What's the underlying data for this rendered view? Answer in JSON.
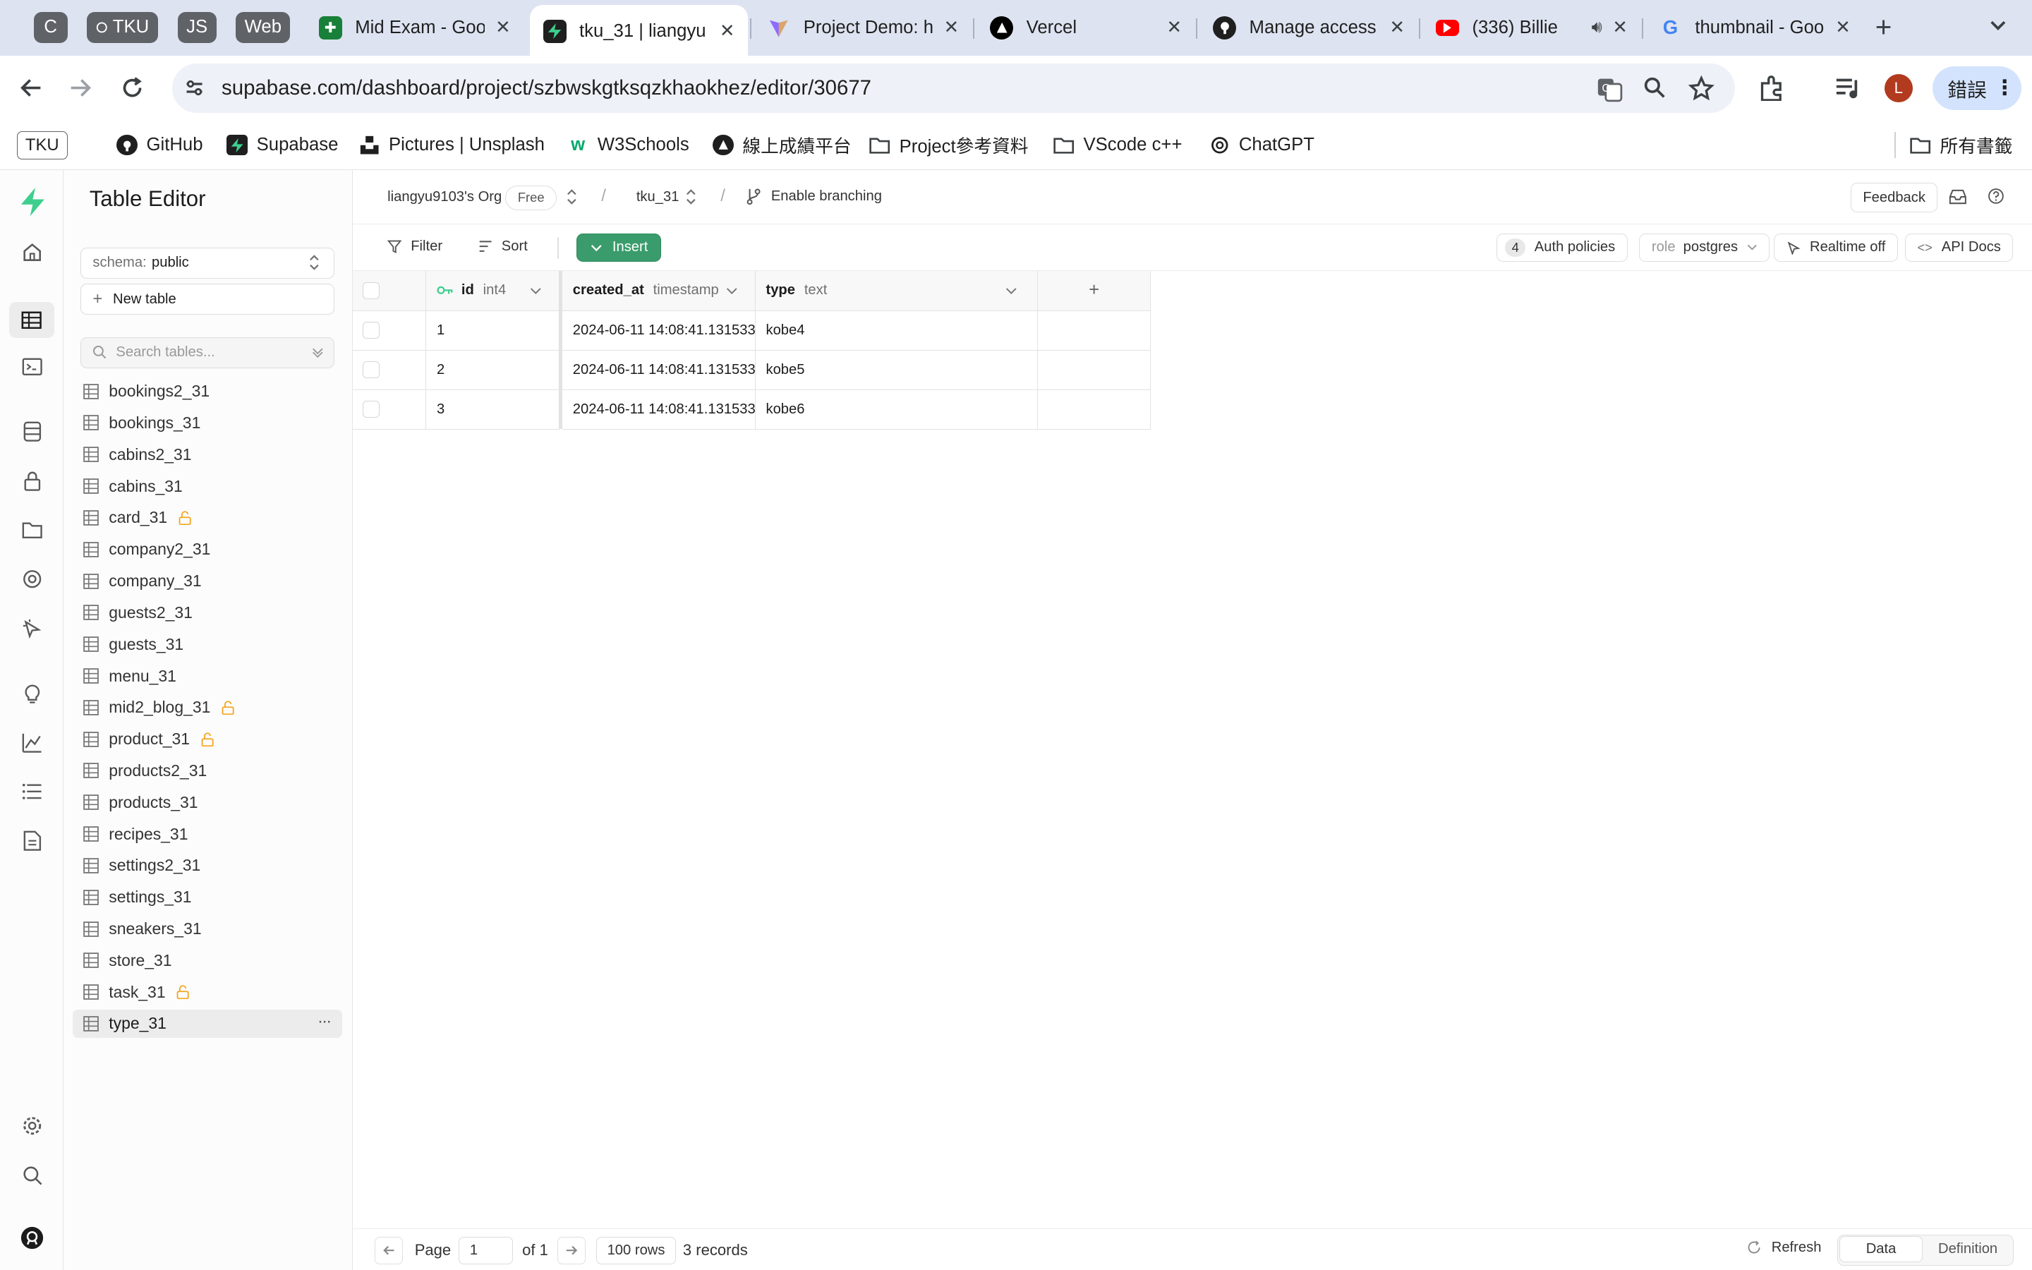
{
  "browser": {
    "tab_groups": [
      "C",
      "TKU",
      "JS",
      "Web"
    ],
    "tabs": [
      {
        "title": "Mid Exam - Goo",
        "favicon": "sheets-icon",
        "color": "#188038"
      },
      {
        "title": "tku_31 | liangyu",
        "favicon": "supabase-icon",
        "color": "#1f1f1f"
      },
      {
        "title": "Project Demo: h",
        "favicon": "vite-icon",
        "color": "#8a6cff"
      },
      {
        "title": "Vercel",
        "favicon": "vercel-icon",
        "color": "#000000"
      },
      {
        "title": "Manage access",
        "favicon": "github-icon",
        "color": "#1f1f1f"
      },
      {
        "title": "(336) Billie",
        "favicon": "youtube-icon",
        "color": "#ff0000"
      },
      {
        "title": "thumbnail - Goo",
        "favicon": "google-icon",
        "color": "#4285f4"
      }
    ],
    "url_host": "supabase.com",
    "url_path": "/dashboard/project/szbwskgtksqzkhaokhez/editor/30677",
    "profile_initial": "L",
    "error_button": "錯誤",
    "bookmarks": [
      {
        "label": "TKU",
        "icon": "tku-badge"
      },
      {
        "label": "GitHub",
        "icon": "github-icon"
      },
      {
        "label": "Supabase",
        "icon": "supabase-icon"
      },
      {
        "label": "Pictures | Unsplash",
        "icon": "unsplash-icon"
      },
      {
        "label": "W3Schools",
        "icon": "w3schools-icon"
      },
      {
        "label": "線上成績平台",
        "icon": "triangle-logo-icon"
      },
      {
        "label": "Project參考資料",
        "icon": "folder-icon"
      },
      {
        "label": "VScode c++",
        "icon": "folder-icon"
      },
      {
        "label": "ChatGPT",
        "icon": "chatgpt-icon"
      }
    ],
    "all_bookmarks": "所有書籤"
  },
  "sidebar": {
    "title": "Table Editor",
    "schema_label": "schema:",
    "schema_value": "public",
    "new_table": "New table",
    "search_placeholder": "Search tables...",
    "tables": [
      {
        "name": "bookings2_31",
        "locked": false
      },
      {
        "name": "bookings_31",
        "locked": false
      },
      {
        "name": "cabins2_31",
        "locked": false
      },
      {
        "name": "cabins_31",
        "locked": false
      },
      {
        "name": "card_31",
        "locked": true
      },
      {
        "name": "company2_31",
        "locked": false
      },
      {
        "name": "company_31",
        "locked": false
      },
      {
        "name": "guests2_31",
        "locked": false
      },
      {
        "name": "guests_31",
        "locked": false
      },
      {
        "name": "menu_31",
        "locked": false
      },
      {
        "name": "mid2_blog_31",
        "locked": true
      },
      {
        "name": "product_31",
        "locked": true
      },
      {
        "name": "products2_31",
        "locked": false
      },
      {
        "name": "products_31",
        "locked": false
      },
      {
        "name": "recipes_31",
        "locked": false
      },
      {
        "name": "settings2_31",
        "locked": false
      },
      {
        "name": "settings_31",
        "locked": false
      },
      {
        "name": "sneakers_31",
        "locked": false
      },
      {
        "name": "store_31",
        "locked": false
      },
      {
        "name": "task_31",
        "locked": true
      },
      {
        "name": "type_31",
        "locked": false,
        "selected": true
      }
    ]
  },
  "topbar": {
    "org": "liangyu9103's Org",
    "plan": "Free",
    "project": "tku_31",
    "branching": "Enable branching",
    "feedback": "Feedback"
  },
  "toolbar": {
    "filter": "Filter",
    "sort": "Sort",
    "insert": "Insert",
    "auth_count": "4",
    "auth_policies": "Auth policies",
    "role_label": "role",
    "role_value": "postgres",
    "realtime": "Realtime off",
    "api_docs": "API Docs"
  },
  "grid": {
    "columns": [
      {
        "name": "id",
        "type": "int4",
        "primary_key": true
      },
      {
        "name": "created_at",
        "type": "timestamp"
      },
      {
        "name": "type",
        "type": "text"
      }
    ],
    "add_column": "+",
    "rows": [
      [
        "1",
        "2024-06-11 14:08:41.131533",
        "kobe4"
      ],
      [
        "2",
        "2024-06-11 14:08:41.131533",
        "kobe5"
      ],
      [
        "3",
        "2024-06-11 14:08:41.131533",
        "kobe6"
      ]
    ]
  },
  "footer": {
    "page_label": "Page",
    "page_value": "1",
    "of_pages": "of 1",
    "rows_per_page": "100 rows",
    "records": "3 records",
    "refresh": "Refresh",
    "tab_data": "Data",
    "tab_definition": "Definition"
  },
  "colors": {
    "brand_green": "#3ecf8e",
    "insert_green": "#3a9c6c",
    "lock_orange": "#f5a623",
    "tabbar_bg": "#dde3f0"
  }
}
